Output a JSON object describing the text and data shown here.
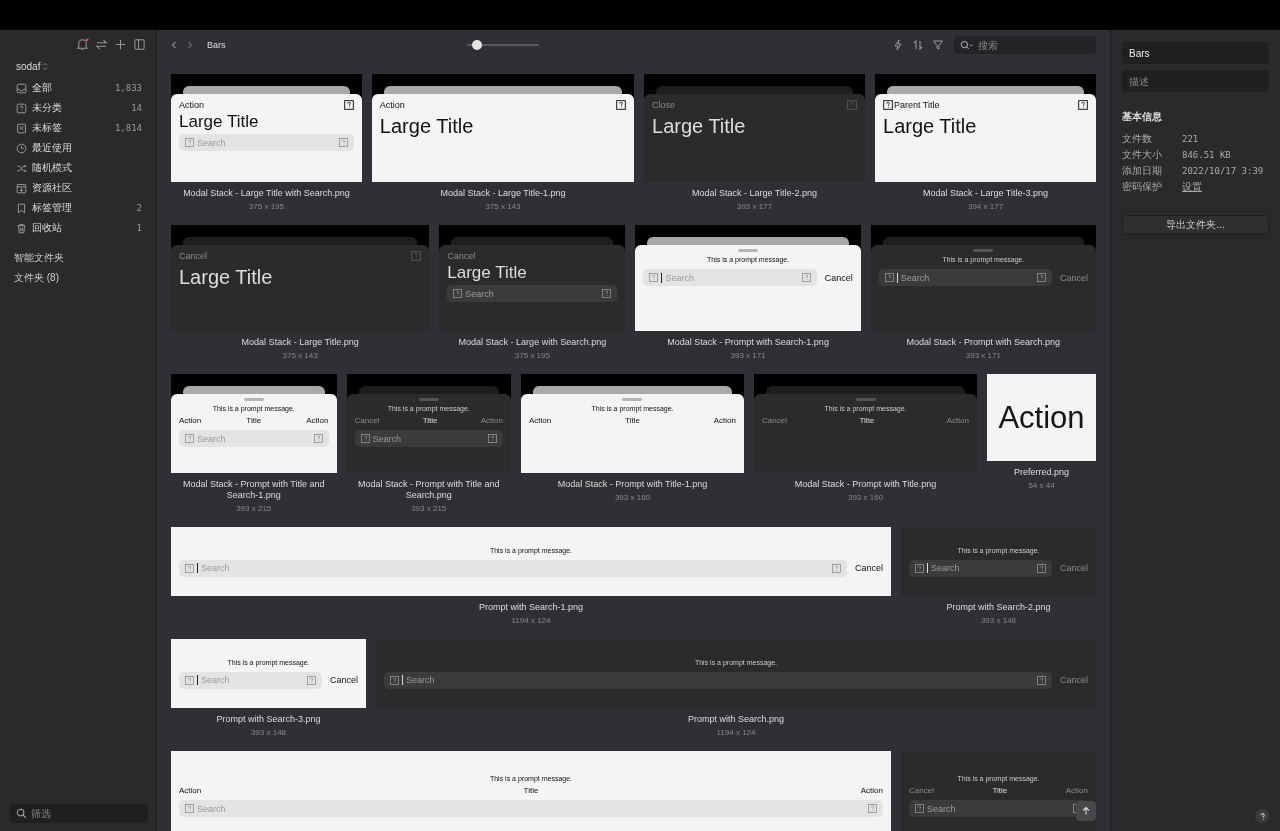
{
  "sidebar": {
    "library": "sodaf",
    "items": [
      {
        "label": "全部",
        "count": "1,833"
      },
      {
        "label": "未分类",
        "count": "14"
      },
      {
        "label": "未标签",
        "count": "1,814"
      },
      {
        "label": "最近使用"
      },
      {
        "label": "随机模式"
      },
      {
        "label": "资源社区"
      },
      {
        "label": "标签管理",
        "count": "2"
      },
      {
        "label": "回收站",
        "count": "1"
      }
    ],
    "sections": [
      "智能文件夹",
      "文件夹 (8)"
    ],
    "filter": {
      "placeholder": "筛选"
    }
  },
  "toolbar": {
    "title": "Bars",
    "zoom": {
      "level": 0.14
    },
    "search": {
      "placeholder": "搜索"
    }
  },
  "rows": [
    {
      "items": [
        {
          "kind": "large-title",
          "dark": false,
          "modal": true,
          "top_label": "Action",
          "corner_icon": true,
          "title": "Large Title",
          "search": "Search",
          "file": "Modal Stack - Large Title with Search.png",
          "size": "375 x 195"
        },
        {
          "kind": "large-title",
          "dark": false,
          "modal": true,
          "top_label": "Action",
          "corner_icon": true,
          "title": "Large Title",
          "file": "Modal Stack - Large Title-1.png",
          "size": "375 x 143"
        },
        {
          "kind": "large-title",
          "dark": true,
          "modal": true,
          "top_label": "Close",
          "corner_icon": true,
          "title": "Large Title",
          "file": "Modal Stack - Large Title-2.png",
          "size": "393 x 177"
        },
        {
          "kind": "large-title",
          "dark": false,
          "modal": true,
          "top_icon_left": true,
          "top_label": "Parent Title",
          "corner_icon": true,
          "title": "Large Title",
          "file": "Modal Stack - Large Title-3.png",
          "size": "394 x 177"
        }
      ]
    },
    {
      "items": [
        {
          "kind": "large-title",
          "dark": true,
          "modal": true,
          "top_label": "Cancel",
          "corner_icon": true,
          "title": "Large Title",
          "file": "Modal Stack - Large Title.png",
          "size": "375 x 143"
        },
        {
          "kind": "large-title",
          "dark": true,
          "modal": true,
          "top_label": "Cancel",
          "title": "Large Title",
          "search": "Search",
          "file": "Modal Stack - Large with Search.png",
          "size": "375 x 195"
        },
        {
          "kind": "prompt-search",
          "dark": false,
          "modal": true,
          "message": "This is a prompt message.",
          "search": "Search",
          "cursor": true,
          "cancel": "Cancel",
          "file": "Modal Stack - Prompt with Search-1.png",
          "size": "393 x 171"
        },
        {
          "kind": "prompt-search",
          "dark": true,
          "modal": true,
          "message": "This is a prompt message.",
          "search": "Search",
          "cursor": true,
          "cancel": "Cancel",
          "file": "Modal Stack - Prompt with Search.png",
          "size": "393 x 171"
        }
      ]
    },
    {
      "items": [
        {
          "kind": "prompt-title",
          "dark": false,
          "modal": true,
          "message": "This is a prompt message.",
          "left": "Action",
          "center": "Title",
          "right": "Action",
          "search": "Search",
          "file": "Modal Stack - Prompt with Title and Search-1.png",
          "size": "393 x 215"
        },
        {
          "kind": "prompt-title",
          "dark": true,
          "modal": true,
          "message": "This is a prompt message.",
          "left": "Cancel",
          "center": "Title",
          "right": "Action",
          "search": "Search",
          "file": "Modal Stack - Prompt with Title and Search.png",
          "size": "393 x 215"
        },
        {
          "kind": "prompt-title",
          "dark": false,
          "modal": true,
          "message": "This is a prompt message.",
          "left": "Action",
          "center": "Title",
          "right": "Action",
          "file": "Modal Stack - Prompt with Title-1.png",
          "size": "393 x 160"
        },
        {
          "kind": "prompt-title",
          "dark": true,
          "modal": true,
          "message": "This is a prompt message.",
          "left": "Cancel",
          "center": "Title",
          "right": "Action",
          "file": "Modal Stack - Prompt with Title.png",
          "size": "393 x 160"
        },
        {
          "kind": "label",
          "text": "Action",
          "file": "Preferred.png",
          "size": "54 x 44"
        }
      ]
    },
    {
      "items": [
        {
          "kind": "prompt-search",
          "dark": false,
          "modal": false,
          "message": "This is a prompt message.",
          "search": "Search",
          "cursor": true,
          "cancel": "Cancel",
          "file": "Prompt with Search-1.png",
          "size": "1194 x 124"
        },
        {
          "kind": "prompt-search",
          "dark": true,
          "modal": false,
          "message": "This is a prompt message.",
          "search": "Search",
          "cursor": true,
          "cancel": "Cancel",
          "file": "Prompt with Search-2.png",
          "size": "393 x 148"
        }
      ]
    },
    {
      "items": [
        {
          "kind": "prompt-search",
          "dark": false,
          "modal": false,
          "message": "This is a prompt message.",
          "search": "Search",
          "cursor": true,
          "cancel": "Cancel",
          "file": "Prompt with Search-3.png",
          "size": "393 x 148"
        },
        {
          "kind": "prompt-search",
          "dark": true,
          "modal": false,
          "message": "This is a prompt message.",
          "search": "Search",
          "cursor": true,
          "cancel": "Cancel",
          "file": "Prompt with Search.png",
          "size": "1194 x 124"
        }
      ]
    },
    {
      "items": [
        {
          "kind": "prompt-title",
          "dark": false,
          "modal": false,
          "message": "This is a prompt message.",
          "left": "Action",
          "center": "Title",
          "right": "Action",
          "search": "Search"
        },
        {
          "kind": "prompt-title",
          "dark": true,
          "modal": false,
          "message": "This is a prompt message.",
          "left": "Cancel",
          "center": "Title",
          "right": "Action",
          "search": "Search"
        }
      ]
    }
  ],
  "inspector": {
    "name": "Bars",
    "description": {
      "placeholder": "描述"
    },
    "heading": "基本信息",
    "info": [
      {
        "label": "文件数",
        "value": "221",
        "kind": "text"
      },
      {
        "label": "文件大小",
        "value": "846.51 KB",
        "kind": "text"
      },
      {
        "label": "添加日期",
        "value": "2022/10/17 3:39",
        "kind": "text"
      },
      {
        "label": "密码保护",
        "value": "设置",
        "kind": "link"
      }
    ],
    "export_button": "导出文件夹..."
  }
}
